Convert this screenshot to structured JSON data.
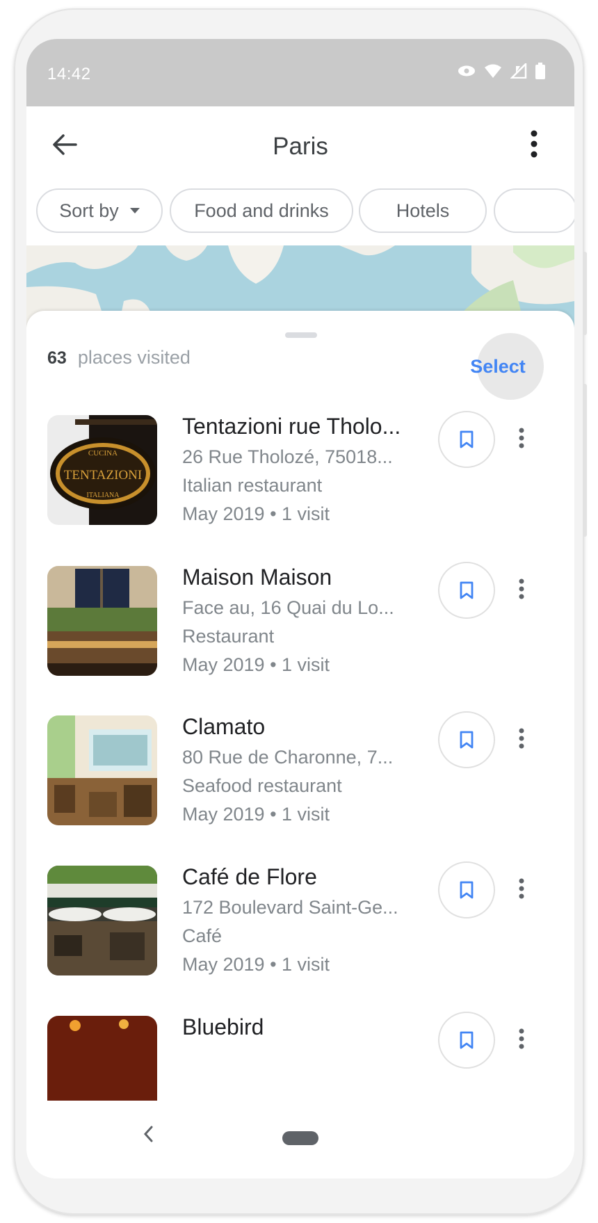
{
  "status": {
    "time": "14:42"
  },
  "header": {
    "title": "Paris"
  },
  "chips": [
    {
      "label": "Sort by"
    },
    {
      "label": "Food and drinks"
    },
    {
      "label": "Hotels"
    }
  ],
  "summary": {
    "count": "63",
    "label": "places visited",
    "select_label": "Select"
  },
  "places": [
    {
      "name": "Tentazioni rue Tholo...",
      "address": "26 Rue Tholozé, 75018...",
      "category": "Italian restaurant",
      "visits": "May 2019 • 1 visit"
    },
    {
      "name": "Maison Maison",
      "address": "Face au, 16 Quai du Lo...",
      "category": "Restaurant",
      "visits": "May 2019 • 1 visit"
    },
    {
      "name": "Clamato",
      "address": "80 Rue de Charonne, 7...",
      "category": "Seafood restaurant",
      "visits": "May 2019 • 1 visit"
    },
    {
      "name": "Café de Flore",
      "address": "172 Boulevard Saint-Ge...",
      "category": "Café",
      "visits": "May 2019 • 1 visit"
    },
    {
      "name": "Bluebird",
      "address": "",
      "category": "",
      "visits": ""
    }
  ],
  "icons": {
    "back": "arrow-back-icon",
    "more": "more-vert-icon",
    "save": "bookmark-icon",
    "caret": "arrow-drop-down-icon"
  },
  "colors": {
    "accent": "#4285f4",
    "status_bar": "#c9c9c9",
    "map_water": "#aad3df"
  }
}
